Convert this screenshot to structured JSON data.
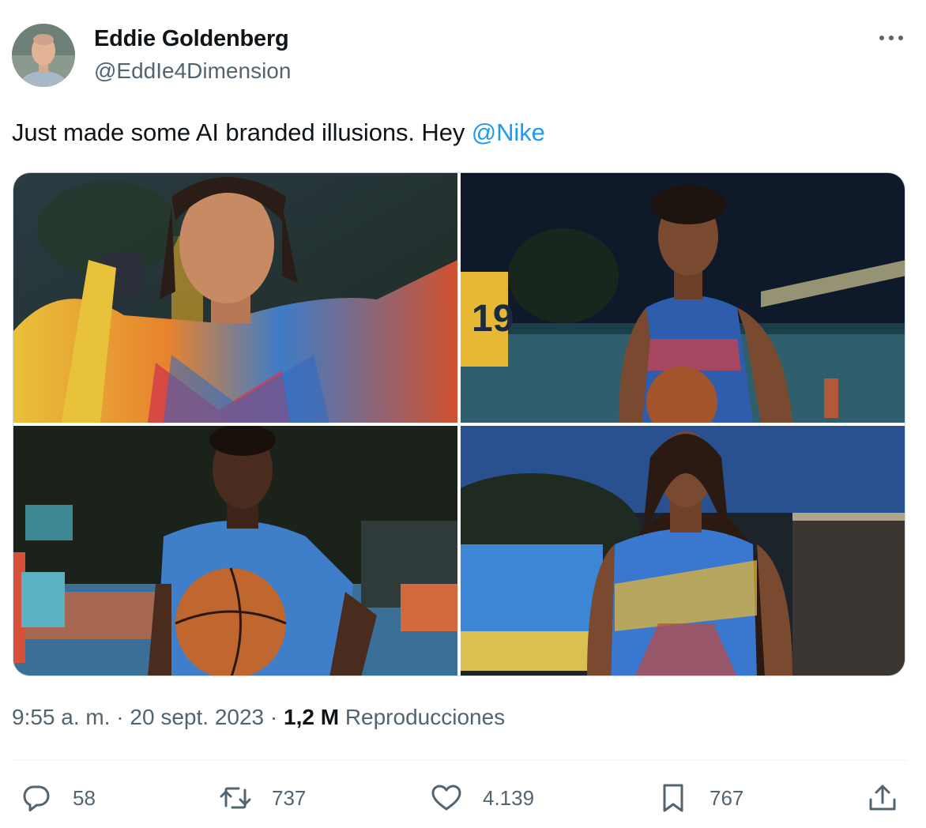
{
  "author": {
    "name": "Eddie Goldenberg",
    "handle": "@EddIe4Dimension",
    "avatar_icon": "user-avatar"
  },
  "tweet": {
    "text": "Just made some AI branded illusions. Hey ",
    "mention": "@Nike"
  },
  "media": {
    "photos": [
      {
        "description": "woman in colorful patterned jacket on basketball court"
      },
      {
        "description": "young man in blue and red basketball jersey holding basketball at night court"
      },
      {
        "description": "young man in blue jersey holding basketball on outdoor court"
      },
      {
        "description": "woman in blue and yellow jersey at night"
      }
    ]
  },
  "meta": {
    "time": "9:55 a. m.",
    "separator": " · ",
    "date": "20 sept. 2023",
    "views_count": "1,2 M",
    "views_label": "Reproducciones"
  },
  "actions": {
    "replies": "58",
    "retweets": "737",
    "likes": "4.139",
    "bookmarks": "767"
  },
  "colors": {
    "text": "#0f1419",
    "secondary": "#536471",
    "link": "#1d9bf0",
    "border": "#cfd9de"
  }
}
